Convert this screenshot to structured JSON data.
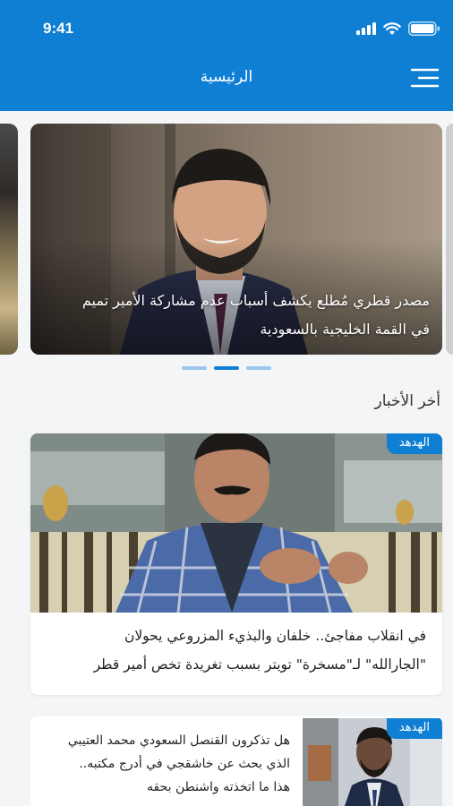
{
  "status_bar": {
    "time": "9:41"
  },
  "header": {
    "title": "الرئيسية"
  },
  "carousel": {
    "caption_line1": "مصدر قطري مُطلع يكشف أسباب عدم مشاركة الأمير تميم",
    "caption_line2": "في القمة الخليجية بالسعودية",
    "slides_count": 3,
    "active_index": 1
  },
  "latest": {
    "title": "أخر الأخبار",
    "items": [
      {
        "source": "الهدهد",
        "line1": "في انقلاب مفاجئ.. خلفان والبذيء المزروعي يحولان",
        "line2": "\"الجارالله\" لـ\"مسخرة\" تويتر بسبب تغريدة تخص أمير قطر"
      },
      {
        "source": "الهدهد",
        "line1": "هل تذكرون القنصل السعودي محمد العتيبي",
        "line2": "الذي بحث عن خاشقجي في أدرج مكتبه..",
        "line3": "هذا ما اتخذته واشنطن بحقه"
      }
    ]
  },
  "colors": {
    "brand": "#0f7fd4",
    "background": "#f4f5f7"
  }
}
